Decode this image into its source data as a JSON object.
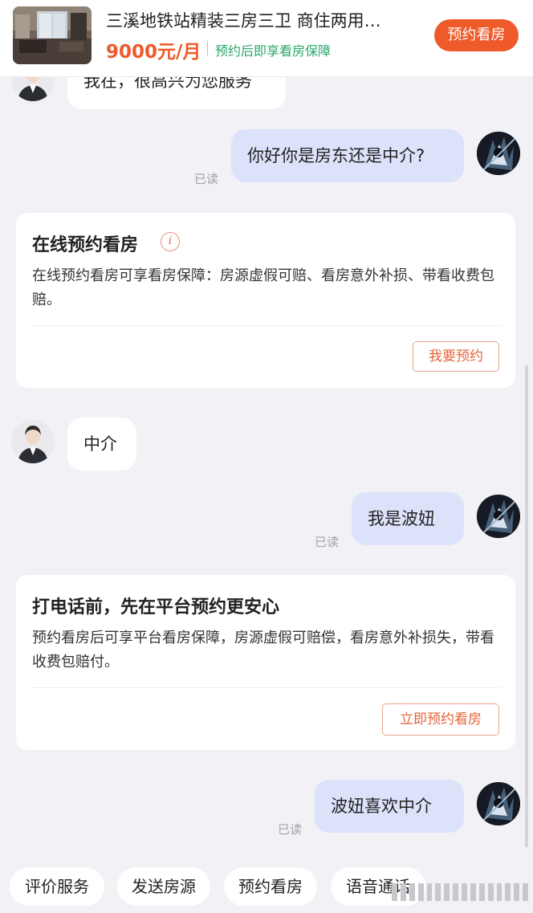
{
  "listing": {
    "title": "三溪地铁站精装三房三卫 商住两用…",
    "price": "9000元/月",
    "guarantee": "预约后即享看房保障",
    "book_label": "预约看房"
  },
  "messages": {
    "agent_greeting": "我在，很高兴为您服务",
    "user_q1": "你好你是房东还是中介?",
    "read_1": "已读",
    "agent_reply": "中介",
    "user_q2": "我是波妞",
    "read_2": "已读",
    "user_q3": "波妞喜欢中介",
    "read_3": "已读"
  },
  "card1": {
    "title": "在线预约看房",
    "body": "在线预约看房可享看房保障：房源虚假可赔、看房意外补损、带看收费包赔。",
    "button": "我要预约",
    "icon": "i"
  },
  "card2": {
    "title": "打电话前，先在平台预约更安心",
    "body": "预约看房后可享平台看房保障，房源虚假可赔偿，看房意外补损失，带看收费包赔付。",
    "button": "立即预约看房"
  },
  "quick_actions": [
    "评价服务",
    "发送房源",
    "预约看房",
    "语音通话"
  ],
  "colors": {
    "accent": "#ef5a2a",
    "guarantee_green": "#29a86b",
    "user_bubble": "#dde2fb",
    "background": "#f1f1f6"
  }
}
